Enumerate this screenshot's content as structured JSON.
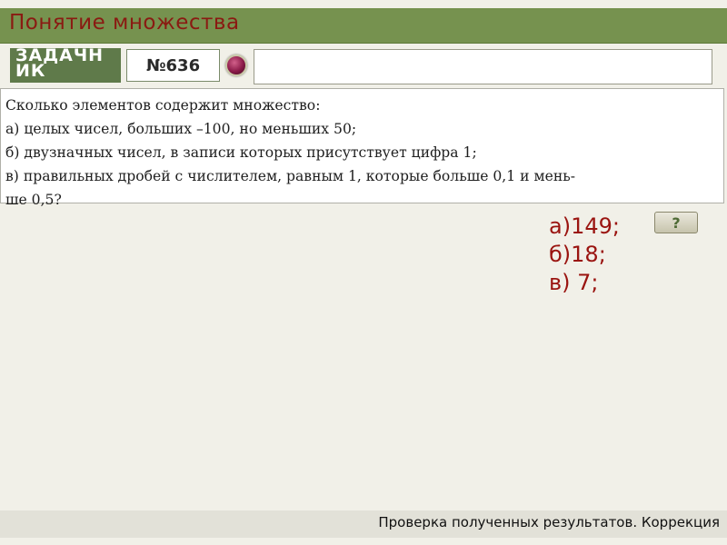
{
  "header": {
    "title": "Понятие множества"
  },
  "toolbar": {
    "tag_label_line1": "ЗАДАЧН",
    "tag_label_line2": "ИК",
    "task_number": "№636",
    "answer_value": ""
  },
  "problem": {
    "lines": [
      "Сколько элементов содержит множество:",
      "а) целых чисел, больших –100, но меньших 50;",
      "б) двузначных чисел, в записи которых присутствует цифра 1;",
      "в) правильных дробей с числителем, равным 1, которые больше 0,1 и мень-",
      "ше 0,5?"
    ]
  },
  "answers": [
    "а)149;",
    "б)18;",
    "в) 7;"
  ],
  "hint_button": {
    "label": "?"
  },
  "footer": {
    "text": "Проверка полученных результатов. Коррекция"
  },
  "colors": {
    "header_bg": "#76924f",
    "header_text": "#8a1a12",
    "answer_text": "#9a1410"
  },
  "icons": {
    "round_button": "record-circle-icon"
  }
}
